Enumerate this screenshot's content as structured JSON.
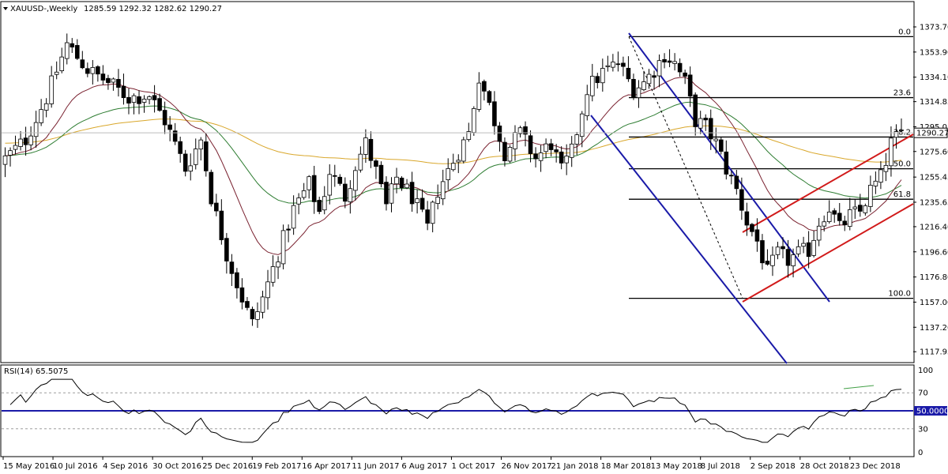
{
  "chart_data": {
    "type": "candlestick",
    "symbol_label": "XAUUSD-,Weekly",
    "ohlc_label": "1285.59 1292.32 1282.62 1290.27",
    "last_price_label": "1290.27",
    "y_range": [
      1110,
      1393
    ],
    "y_ticks": [
      "1373.70",
      "1353.90",
      "1334.10",
      "1314.85",
      "1295.05",
      "1275.60",
      "1255.45",
      "1235.65",
      "1216.40",
      "1196.60",
      "1176.80",
      "1157.00",
      "1137.20",
      "1117.95"
    ],
    "x_labels": [
      "15 May 2016",
      "10 Jul 2016",
      "4 Sep 2016",
      "30 Oct 2016",
      "25 Dec 2016",
      "19 Feb 2017",
      "16 Apr 2017",
      "11 Jun 2017",
      "6 Aug 2017",
      "1 Oct 2017",
      "26 Nov 2017",
      "21 Jan 2018",
      "18 Mar 2018",
      "13 May 2018",
      "8 Jul 2018",
      "2 Sep 2018",
      "28 Oct 2018",
      "23 Dec 2018"
    ],
    "fibonacci": {
      "levels": [
        {
          "label": "0.0",
          "price": 1366
        },
        {
          "label": "23.6",
          "price": 1318
        },
        {
          "label": "38.2",
          "price": 1287
        },
        {
          "label": "50.0",
          "price": 1262
        },
        {
          "label": "61.8",
          "price": 1238
        },
        {
          "label": "100.0",
          "price": 1160
        }
      ]
    },
    "colors": {
      "bull": "#ffffff",
      "bear": "#000000",
      "ma_orange": "#d9a72b",
      "ma_green": "#2e7d32",
      "ma_maroon": "#7a2230",
      "blue_channel": "#1a1aa8",
      "red_channel": "#d11a1a",
      "rsi_line": "#000000",
      "rsi_mid": "#1a1aa8"
    },
    "rsi": {
      "label": "RSI(14) 65.5075",
      "ticks": [
        "100",
        "70",
        "50.0000",
        "30",
        "0"
      ]
    }
  }
}
